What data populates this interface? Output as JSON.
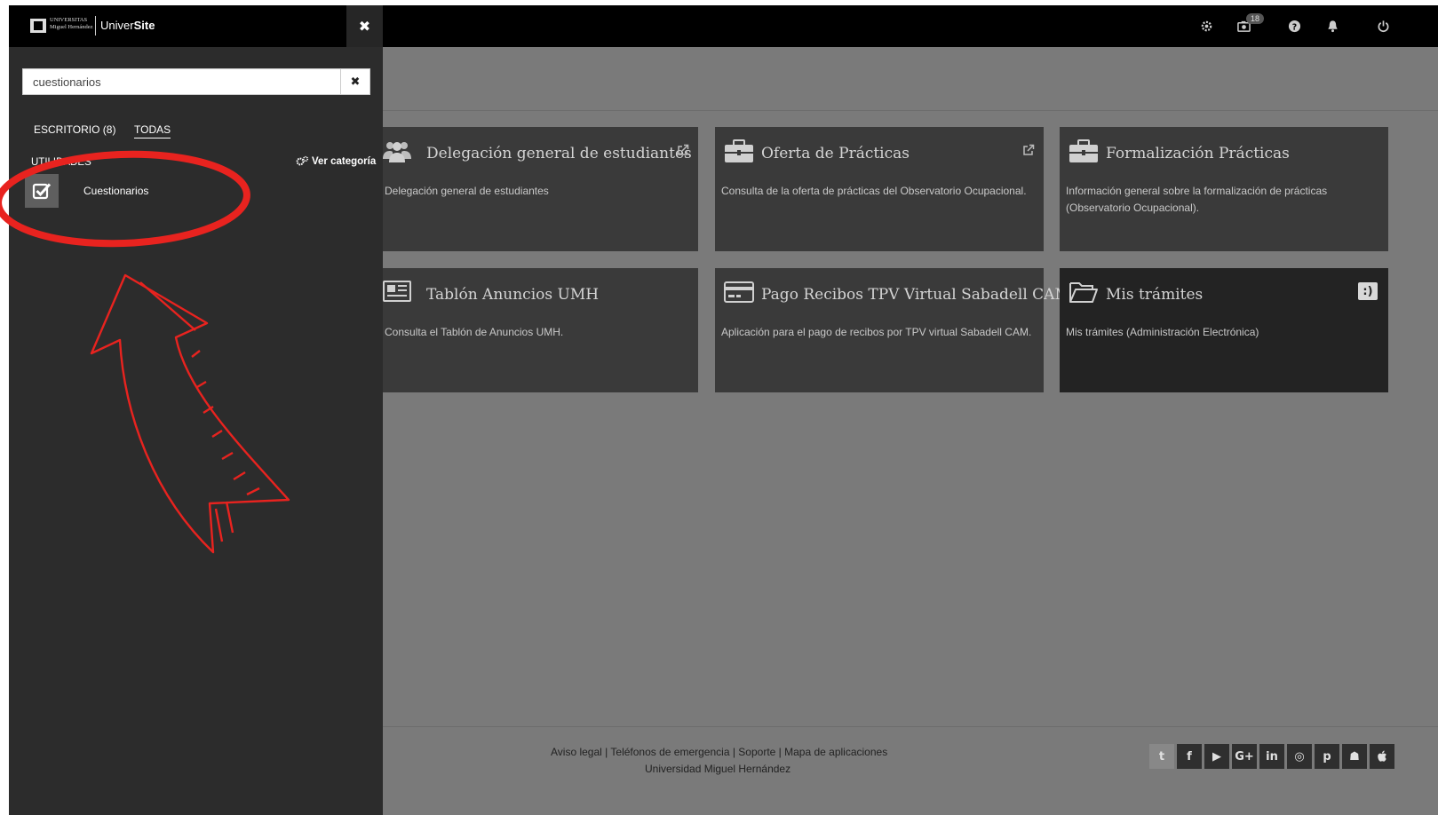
{
  "topbar": {
    "icons": [
      "gear-icon",
      "camera-icon",
      "question-icon",
      "bell-icon",
      "power-icon"
    ],
    "messages_badge": "18"
  },
  "sidebar": {
    "brand_prefix": "Univer",
    "brand_bold": "Site",
    "logo_line1": "UNIVERSITAS",
    "logo_line2": "Miguel Hernández",
    "close_label": "✖",
    "search": {
      "value": "cuestionarios",
      "clear_label": "✖"
    },
    "tabs": [
      {
        "label": "ESCRITORIO (8)"
      },
      {
        "label": "TODAS"
      }
    ],
    "category": {
      "label": "UTILIDADES",
      "link": "Ver categoría"
    },
    "results": [
      {
        "label": "Cuestionarios",
        "icon": "checkbox-icon"
      }
    ]
  },
  "cards": [
    {
      "title": "Delegación general de estudiantes",
      "description": "Delegación general de estudiantes",
      "icon": "users-icon"
    },
    {
      "title": "Oferta de Prácticas",
      "description": "Consulta de la oferta de prácticas del Observatorio Ocupacional.",
      "icon": "briefcase-icon"
    },
    {
      "title": "Formalización Prácticas",
      "description": "Información general sobre la formalización de prácticas (Observatorio Ocupacional).",
      "icon": "briefcase-icon"
    },
    {
      "title": "Tablón Anuncios UMH",
      "description": "Consulta el Tablón de Anuncios UMH.",
      "icon": "newspaper-icon"
    },
    {
      "title": "Pago Recibos TPV Virtual Sabadell CAM",
      "description": "Aplicación para el pago de recibos por TPV virtual Sabadell CAM.",
      "icon": "credit-card-icon"
    },
    {
      "title": "Mis trámites",
      "description": "Mis trámites (Administración Electrónica)",
      "icon": "folder-open-icon",
      "badge": ":)"
    }
  ],
  "footer": {
    "links": [
      "Aviso legal",
      "Teléfonos de emergencia",
      "Soporte",
      "Mapa de aplicaciones"
    ],
    "separator": " | ",
    "university": "Universidad Miguel Hernández",
    "social": [
      {
        "name": "twitter-icon",
        "glyph": "t"
      },
      {
        "name": "facebook-icon",
        "glyph": "f"
      },
      {
        "name": "youtube-icon",
        "glyph": "▶"
      },
      {
        "name": "google-plus-icon",
        "glyph": "G+"
      },
      {
        "name": "linkedin-icon",
        "glyph": "in"
      },
      {
        "name": "instagram-icon",
        "glyph": "◎"
      },
      {
        "name": "pinterest-icon",
        "glyph": "p"
      },
      {
        "name": "android-icon",
        "glyph": "☗"
      },
      {
        "name": "apple-icon",
        "glyph": ""
      }
    ]
  },
  "colors": {
    "annotation": "#e8231f",
    "sidebar_bg": "#2c2c2c",
    "main_bg": "#7a7a7a",
    "card_bg": "#3a3a3a"
  }
}
